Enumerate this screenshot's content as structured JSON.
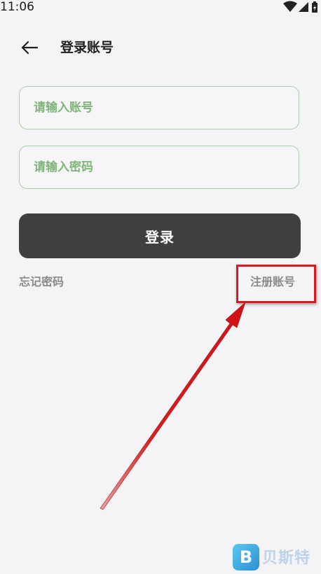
{
  "status_bar": {
    "time": "11:06"
  },
  "header": {
    "title": "登录账号"
  },
  "form": {
    "account_placeholder": "请输入账号",
    "password_placeholder": "请输入密码",
    "login_label": "登录",
    "forgot_label": "忘记密码",
    "register_label": "注册账号"
  },
  "colors": {
    "background": "#f4f4f6",
    "field_border": "#a9cfa3",
    "placeholder": "#7fb579",
    "button": "#3f3f41",
    "highlight": "#d71a1f"
  },
  "icons": {
    "back": "arrow-left-icon",
    "wifi": "wifi-icon",
    "signal": "signal-icon",
    "battery": "battery-charging-icon"
  },
  "watermark": {
    "logo_letter": "B",
    "text": "贝斯特"
  }
}
